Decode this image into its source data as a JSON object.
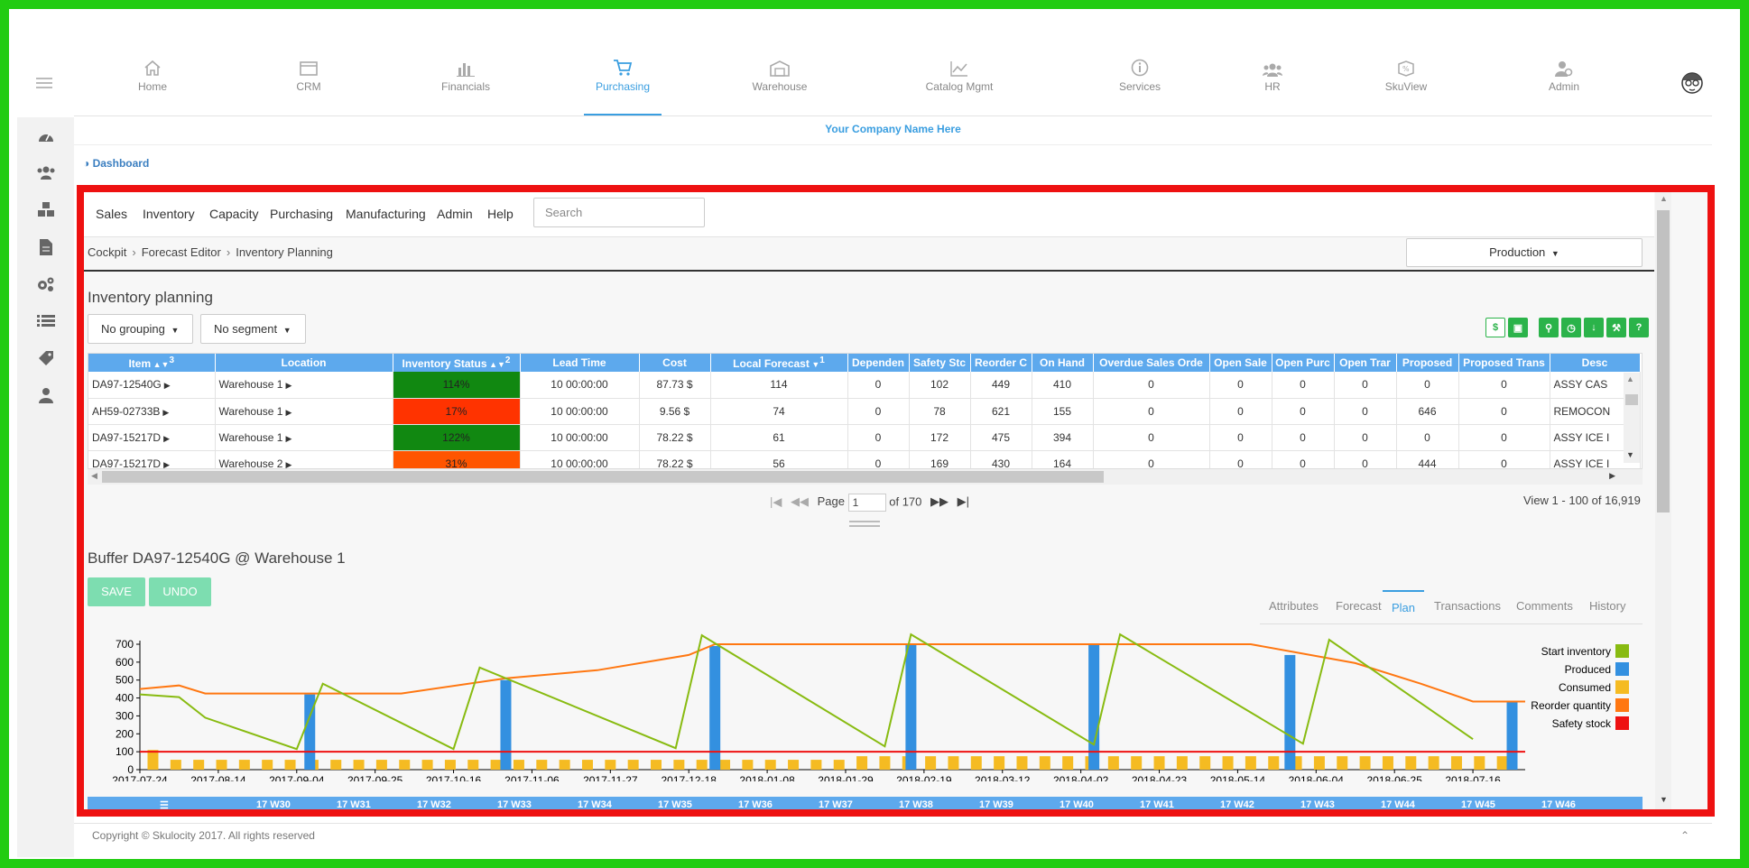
{
  "nav": {
    "items": [
      {
        "label": "Home",
        "icon": "home-icon"
      },
      {
        "label": "CRM",
        "icon": "crm-icon"
      },
      {
        "label": "Financials",
        "icon": "bar-chart-icon"
      },
      {
        "label": "Purchasing",
        "icon": "cart-icon",
        "active": true
      },
      {
        "label": "Warehouse",
        "icon": "warehouse-icon"
      },
      {
        "label": "Catalog Mgmt",
        "icon": "line-chart-icon"
      },
      {
        "label": "Services",
        "icon": "info-icon"
      },
      {
        "label": "HR",
        "icon": "users-icon"
      },
      {
        "label": "SkuView",
        "icon": "skuview-icon"
      },
      {
        "label": "Admin",
        "icon": "admin-icon"
      }
    ]
  },
  "company_name": "Your Company Name Here",
  "dashboard_link": "Dashboard",
  "app_menu": {
    "items": [
      "Sales",
      "Inventory",
      "Capacity",
      "Purchasing",
      "Manufacturing",
      "Admin",
      "Help"
    ],
    "search_placeholder": "Search"
  },
  "breadcrumb": {
    "items": [
      "Cockpit",
      "Forecast Editor",
      "Inventory Planning"
    ]
  },
  "scenario_button": "Production",
  "inventory": {
    "title": "Inventory planning",
    "grouping": "No grouping",
    "segment": "No segment",
    "columns": [
      "Item",
      "Location",
      "Inventory Status",
      "Lead Time",
      "Cost",
      "Local Forecast",
      "Dependen",
      "Safety Stc",
      "Reorder C",
      "On Hand",
      "Overdue Sales Orde",
      "Open Sale",
      "Open Purc",
      "Open Trar",
      "Proposed",
      "Proposed Trans",
      "Desc"
    ],
    "sort_marks": {
      "item": "3",
      "status": "2",
      "forecast": "1"
    },
    "rows": [
      {
        "item": "DA97-12540G",
        "location": "Warehouse 1",
        "status": "114%",
        "status_color": "#118811",
        "lead": "10 00:00:00",
        "cost": "87.73 $",
        "forecast": "114",
        "dep": "0",
        "safety": "102",
        "reorder": "449",
        "onhand": "410",
        "overdue": "0",
        "opensale": "0",
        "openpurc": "0",
        "opentrans": "0",
        "proposed": "0",
        "proptrans": "0",
        "desc": "ASSY CAS"
      },
      {
        "item": "AH59-02733B",
        "location": "Warehouse 1",
        "status": "17%",
        "status_color": "#ff3300",
        "lead": "10 00:00:00",
        "cost": "9.56 $",
        "forecast": "74",
        "dep": "0",
        "safety": "78",
        "reorder": "621",
        "onhand": "155",
        "overdue": "0",
        "opensale": "0",
        "openpurc": "0",
        "opentrans": "0",
        "proposed": "646",
        "proptrans": "0",
        "desc": "REMOCON"
      },
      {
        "item": "DA97-15217D",
        "location": "Warehouse 1",
        "status": "122%",
        "status_color": "#118811",
        "lead": "10 00:00:00",
        "cost": "78.22 $",
        "forecast": "61",
        "dep": "0",
        "safety": "172",
        "reorder": "475",
        "onhand": "394",
        "overdue": "0",
        "opensale": "0",
        "openpurc": "0",
        "opentrans": "0",
        "proposed": "0",
        "proptrans": "0",
        "desc": "ASSY ICE I"
      },
      {
        "item": "DA97-15217D",
        "location": "Warehouse 2",
        "status": "31%",
        "status_color": "#ff5500",
        "lead": "10 00:00:00",
        "cost": "78.22 $",
        "forecast": "56",
        "dep": "0",
        "safety": "169",
        "reorder": "430",
        "onhand": "164",
        "overdue": "0",
        "opensale": "0",
        "openpurc": "0",
        "opentrans": "0",
        "proposed": "444",
        "proptrans": "0",
        "desc": "ASSY ICE I"
      }
    ]
  },
  "pager": {
    "page_label": "Page",
    "page_value": "1",
    "of_label": "of 170",
    "view_text": "View 1 - 100 of 16,919"
  },
  "buffer": {
    "title": "Buffer DA97-12540G @ Warehouse 1",
    "save": "SAVE",
    "undo": "UNDO",
    "tabs": [
      "Attributes",
      "Forecast",
      "Plan",
      "Transactions",
      "Comments",
      "History"
    ],
    "active_tab": "Plan"
  },
  "chart_data": {
    "type": "bar",
    "x_tick_labels": [
      "2017-07-24",
      "2017-08-14",
      "2017-09-04",
      "2017-09-25",
      "2017-10-16",
      "2017-11-06",
      "2017-11-27",
      "2017-12-18",
      "2018-01-08",
      "2018-01-29",
      "2018-02-19",
      "2018-03-12",
      "2018-04-02",
      "2018-04-23",
      "2018-05-14",
      "2018-06-04",
      "2018-06-25",
      "2018-07-16"
    ],
    "ylim": [
      0,
      700
    ],
    "y_ticks": [
      0,
      100,
      200,
      300,
      400,
      500,
      600,
      700
    ],
    "weeks": 60,
    "series": [
      {
        "name": "Start inventory",
        "color": "#88bb11",
        "points": [
          [
            0,
            420
          ],
          [
            3,
            405
          ],
          [
            5,
            290
          ],
          [
            12,
            115
          ],
          [
            14,
            480
          ],
          [
            24,
            115
          ],
          [
            26,
            570
          ],
          [
            41,
            120
          ],
          [
            43,
            750
          ],
          [
            57,
            130
          ],
          [
            59,
            755
          ],
          [
            73,
            140
          ],
          [
            75,
            755
          ],
          [
            89,
            145
          ],
          [
            91,
            725
          ],
          [
            102,
            170
          ]
        ]
      },
      {
        "name": "Produced",
        "color": "#3390e0",
        "points": [
          [
            13,
            420
          ],
          [
            28,
            500
          ],
          [
            44,
            690
          ],
          [
            59,
            700
          ],
          [
            73,
            700
          ],
          [
            88,
            640
          ],
          [
            105,
            380
          ]
        ]
      },
      {
        "name": "Consumed",
        "color": "#f5bb22",
        "value": 55
      },
      {
        "name": "Reorder quantity",
        "color": "#ff7711",
        "points": [
          [
            0,
            450
          ],
          [
            3,
            470
          ],
          [
            5,
            425
          ],
          [
            20,
            425
          ],
          [
            28,
            510
          ],
          [
            35,
            555
          ],
          [
            42,
            640
          ],
          [
            44,
            700
          ],
          [
            73,
            700
          ],
          [
            85,
            700
          ],
          [
            93,
            595
          ],
          [
            98,
            480
          ],
          [
            102,
            380
          ],
          [
            106,
            380
          ]
        ]
      },
      {
        "name": "Safety stock",
        "color": "#ee1111",
        "value": 100
      }
    ]
  },
  "bottom_grid_cols": [
    "17 W30",
    "17 W31",
    "17 W32",
    "17 W33",
    "17 W34",
    "17 W35",
    "17 W36",
    "17 W37",
    "17 W38",
    "17 W39",
    "17 W40",
    "17 W41",
    "17 W42",
    "17 W43",
    "17 W44",
    "17 W45",
    "17 W46"
  ],
  "footer": {
    "copyright": "Copyright © Skulocity 2017. All rights reserved"
  }
}
